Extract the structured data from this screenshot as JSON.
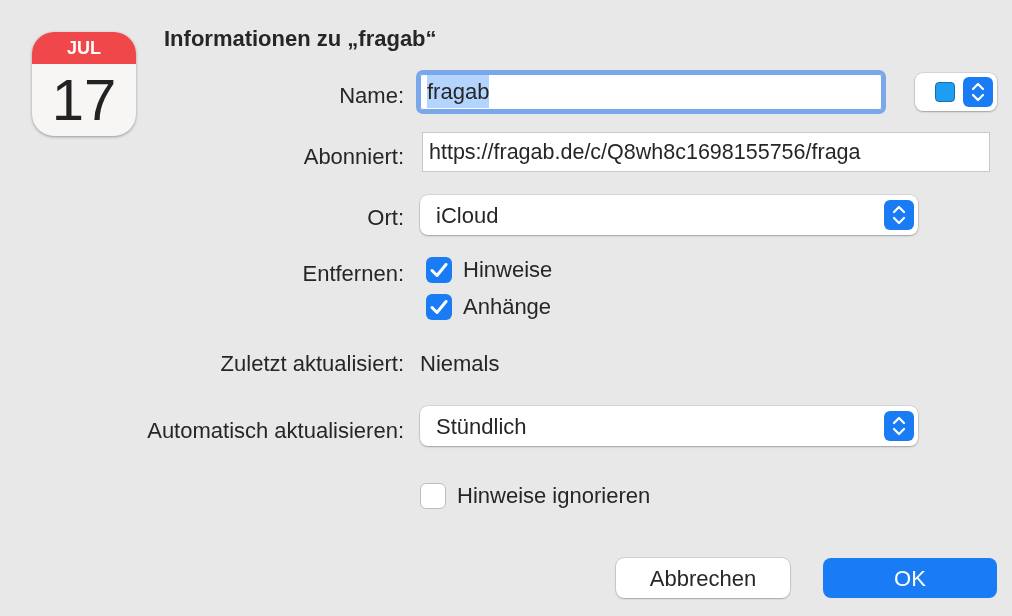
{
  "icon": {
    "month": "JUL",
    "day": "17"
  },
  "title": "Informationen zu „fragab“",
  "name": {
    "label": "Name:",
    "value": "fragab",
    "text_selected": true,
    "focused": true,
    "color": "#1e9ef2"
  },
  "subscribed": {
    "label": "Abonniert:",
    "value": "https://fragab.de/c/Q8wh8c1698155756/fraga"
  },
  "location": {
    "label": "Ort:",
    "value": "iCloud"
  },
  "remove": {
    "label": "Entfernen:",
    "options": [
      {
        "label": "Hinweise",
        "checked": true
      },
      {
        "label": "Anhänge",
        "checked": true
      }
    ]
  },
  "last_updated": {
    "label": "Zuletzt aktualisiert:",
    "value": "Niemals"
  },
  "auto_refresh": {
    "label": "Automatisch aktualisieren:",
    "value": "Stündlich"
  },
  "ignore_alerts": {
    "label": "Hinweise ignorieren",
    "checked": false
  },
  "buttons": [
    {
      "label": "Abbrechen",
      "kind": "secondary"
    },
    {
      "label": "OK",
      "kind": "default"
    }
  ]
}
